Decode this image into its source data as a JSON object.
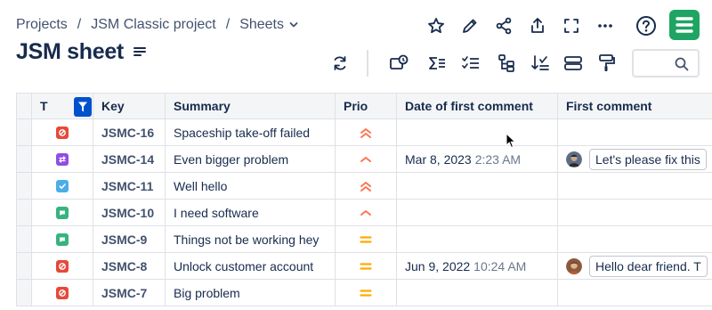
{
  "breadcrumb": {
    "items": [
      "Projects",
      "JSM Classic project",
      "Sheets"
    ],
    "separator": "/"
  },
  "page": {
    "title": "JSM sheet"
  },
  "top_actions": [
    "star-icon",
    "pencil-icon",
    "share-icon",
    "export-icon",
    "fullscreen-icon",
    "more-icon",
    "help-icon"
  ],
  "toolbar": {
    "icons": [
      "refresh-icon",
      "layers-icon",
      "sum-icon",
      "checklist-icon",
      "hierarchy-icon",
      "sort-icon",
      "group-icon",
      "paint-roller-icon"
    ],
    "search_placeholder": ""
  },
  "columns": {
    "type": "T",
    "key": "Key",
    "summary": "Summary",
    "prio": "Prio",
    "date": "Date of first comment",
    "comment": "First comment"
  },
  "colors": {
    "accent": "#0052cc",
    "type_incident": "#e5493a",
    "type_change": "#904ee2",
    "type_task": "#4bade8",
    "type_request": "#36b37e",
    "prio_high": "#ff7452",
    "prio_medium": "#ffab00",
    "app_logo": "#1fa463"
  },
  "rows": [
    {
      "type": "incident",
      "key": "JSMC-16",
      "summary": "Spaceship take-off failed",
      "prio": "highest",
      "date": "",
      "time": "",
      "comment": ""
    },
    {
      "type": "change",
      "key": "JSMC-14",
      "summary": "Even bigger problem",
      "prio": "high",
      "date": "Mar 8, 2023",
      "time": "2:23 AM",
      "comment": "Let's please fix this"
    },
    {
      "type": "task",
      "key": "JSMC-11",
      "summary": "Well hello",
      "prio": "highest",
      "date": "",
      "time": "",
      "comment": ""
    },
    {
      "type": "request",
      "key": "JSMC-10",
      "summary": "I need software",
      "prio": "high",
      "date": "",
      "time": "",
      "comment": ""
    },
    {
      "type": "request",
      "key": "JSMC-9",
      "summary": "Things not be working hey",
      "prio": "medium",
      "date": "",
      "time": "",
      "comment": ""
    },
    {
      "type": "incident",
      "key": "JSMC-8",
      "summary": "Unlock customer account",
      "prio": "medium",
      "date": "Jun 9, 2022",
      "time": "10:24 AM",
      "comment": "Hello dear friend. T"
    },
    {
      "type": "incident",
      "key": "JSMC-7",
      "summary": "Big problem",
      "prio": "medium",
      "date": "",
      "time": "",
      "comment": ""
    }
  ]
}
